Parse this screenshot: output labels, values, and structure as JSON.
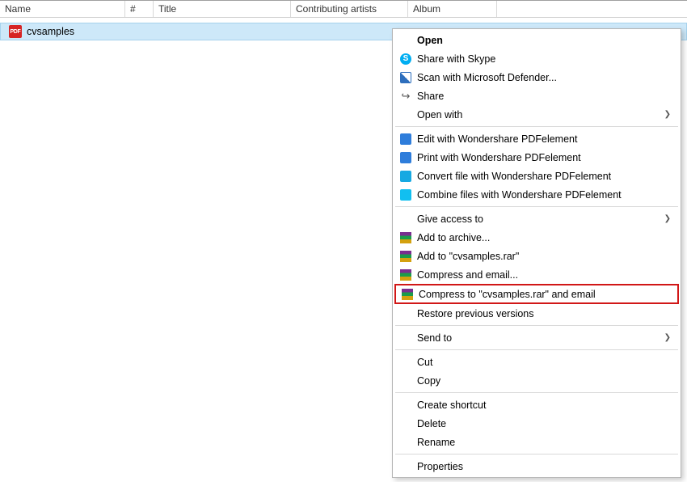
{
  "columns": [
    "Name",
    "#",
    "Title",
    "Contributing artists",
    "Album"
  ],
  "file": {
    "name": "cvsamples",
    "icon_text": "PDF"
  },
  "menu": {
    "open": "Open",
    "skype": "Share with Skype",
    "defender": "Scan with Microsoft Defender...",
    "share": "Share",
    "openwith": "Open with",
    "edit_pdf": "Edit with Wondershare PDFelement",
    "print_pdf": "Print with Wondershare PDFelement",
    "conv_pdf": "Convert file with Wondershare PDFelement",
    "comb_pdf": "Combine files with Wondershare PDFelement",
    "give_access": "Give access to",
    "add_archive": "Add to archive...",
    "add_rar": "Add to \"cvsamples.rar\"",
    "compress_email": "Compress and email...",
    "compress_rar_email": "Compress to \"cvsamples.rar\" and email",
    "restore": "Restore previous versions",
    "send_to": "Send to",
    "cut": "Cut",
    "copy": "Copy",
    "shortcut": "Create shortcut",
    "delete": "Delete",
    "rename": "Rename",
    "properties": "Properties"
  }
}
